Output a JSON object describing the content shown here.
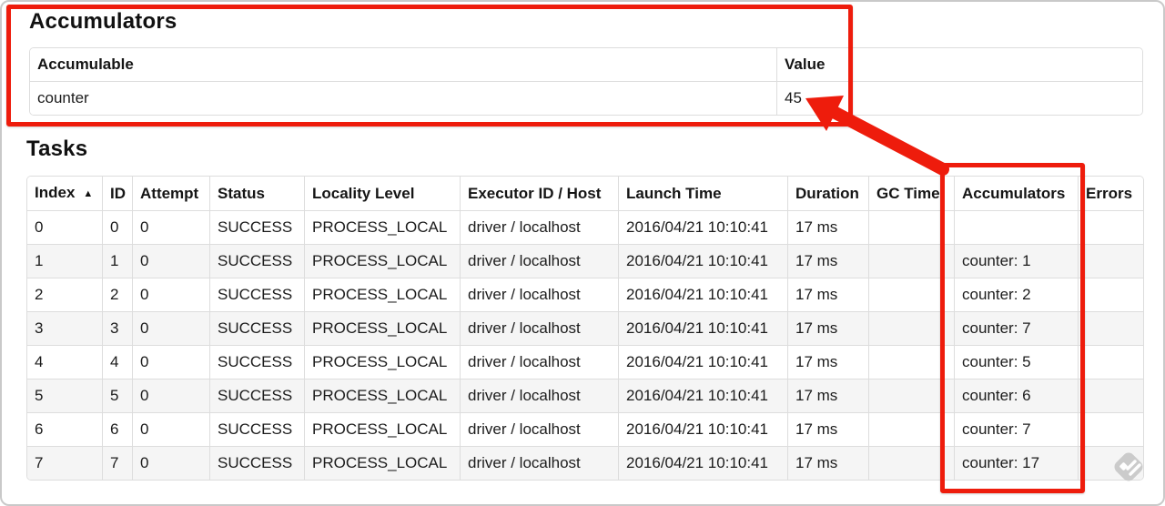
{
  "colors": {
    "annotation_red": "#ee1c0c",
    "row_stripe": "#f5f5f5",
    "table_border": "#dddddd",
    "watermark_gray": "#c9c9c9"
  },
  "accumulators_section": {
    "heading": "Accumulators",
    "columns": {
      "accumulable": "Accumulable",
      "value": "Value"
    },
    "rows": [
      {
        "accumulable": "counter",
        "value": "45"
      }
    ]
  },
  "tasks_section": {
    "heading": "Tasks",
    "sort_indicator": "▲",
    "columns": {
      "index": "Index",
      "id": "ID",
      "attempt": "Attempt",
      "status": "Status",
      "locality": "Locality Level",
      "executor": "Executor ID / Host",
      "launch": "Launch Time",
      "duration": "Duration",
      "gc": "GC Time",
      "accumulators": "Accumulators",
      "errors": "Errors"
    },
    "rows": [
      {
        "index": "0",
        "id": "0",
        "attempt": "0",
        "status": "SUCCESS",
        "locality": "PROCESS_LOCAL",
        "executor": "driver / localhost",
        "launch": "2016/04/21 10:10:41",
        "duration": "17 ms",
        "gc": "",
        "accumulators": "",
        "errors": ""
      },
      {
        "index": "1",
        "id": "1",
        "attempt": "0",
        "status": "SUCCESS",
        "locality": "PROCESS_LOCAL",
        "executor": "driver / localhost",
        "launch": "2016/04/21 10:10:41",
        "duration": "17 ms",
        "gc": "",
        "accumulators": "counter: 1",
        "errors": ""
      },
      {
        "index": "2",
        "id": "2",
        "attempt": "0",
        "status": "SUCCESS",
        "locality": "PROCESS_LOCAL",
        "executor": "driver / localhost",
        "launch": "2016/04/21 10:10:41",
        "duration": "17 ms",
        "gc": "",
        "accumulators": "counter: 2",
        "errors": ""
      },
      {
        "index": "3",
        "id": "3",
        "attempt": "0",
        "status": "SUCCESS",
        "locality": "PROCESS_LOCAL",
        "executor": "driver / localhost",
        "launch": "2016/04/21 10:10:41",
        "duration": "17 ms",
        "gc": "",
        "accumulators": "counter: 7",
        "errors": ""
      },
      {
        "index": "4",
        "id": "4",
        "attempt": "0",
        "status": "SUCCESS",
        "locality": "PROCESS_LOCAL",
        "executor": "driver / localhost",
        "launch": "2016/04/21 10:10:41",
        "duration": "17 ms",
        "gc": "",
        "accumulators": "counter: 5",
        "errors": ""
      },
      {
        "index": "5",
        "id": "5",
        "attempt": "0",
        "status": "SUCCESS",
        "locality": "PROCESS_LOCAL",
        "executor": "driver / localhost",
        "launch": "2016/04/21 10:10:41",
        "duration": "17 ms",
        "gc": "",
        "accumulators": "counter: 6",
        "errors": ""
      },
      {
        "index": "6",
        "id": "6",
        "attempt": "0",
        "status": "SUCCESS",
        "locality": "PROCESS_LOCAL",
        "executor": "driver / localhost",
        "launch": "2016/04/21 10:10:41",
        "duration": "17 ms",
        "gc": "",
        "accumulators": "counter: 7",
        "errors": ""
      },
      {
        "index": "7",
        "id": "7",
        "attempt": "0",
        "status": "SUCCESS",
        "locality": "PROCESS_LOCAL",
        "executor": "driver / localhost",
        "launch": "2016/04/21 10:10:41",
        "duration": "17 ms",
        "gc": "",
        "accumulators": "counter: 17",
        "errors": ""
      }
    ]
  }
}
